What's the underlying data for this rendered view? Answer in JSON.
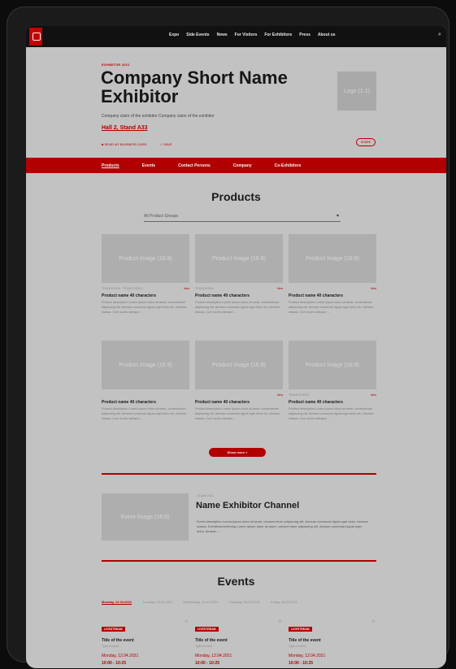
{
  "header": {
    "nav": [
      "Expo",
      "Side Events",
      "News",
      "For Visitors",
      "For Exhibitors",
      "Press",
      "About us"
    ],
    "search_icon": "search-icon"
  },
  "hero": {
    "eyebrow": "EXHIBITOR 2021",
    "title": "Company Short Name Exhibitor",
    "claim": "Company claim of the exhibitor Company claim of the exhibitor",
    "stand": "Hall 2, Stand A33",
    "meta": [
      "SEND MY BUSINESS CARD",
      "SAVE"
    ],
    "share": "SHARE",
    "logo_placeholder": "Logo (1:1)"
  },
  "tabs": [
    "Products",
    "Events",
    "Contact Persons",
    "Company",
    "Co-Exhibitors"
  ],
  "products": {
    "title": "Products",
    "filter": "All Product Groups",
    "cards": [
      {
        "img": "Product Image (16:9)",
        "tag": "TRADESHOW · TRADE-PRESS",
        "new": "New",
        "name": "Product name 40 characters",
        "desc": "Product description Lorem ipsum dolor sit amet, consectetuer adipiscing elit. Aenean commodo ligula eget dolor elu. Aenean massa. Cum sociis natoque ..."
      },
      {
        "img": "Product Image (16:9)",
        "tag": "TRADESHOW",
        "new": "New",
        "name": "Product name 40 characters",
        "desc": "Product description Lorem ipsum dolor sit amet, consectetuer adipiscing elit. Aenean commodo ligula eget dolor elu. Aenean massa. Cum sociis natoque ..."
      },
      {
        "img": "Product Image (16:9)",
        "tag": "",
        "new": "New",
        "name": "Product name 40 characters",
        "desc": "Product description Lorem ipsum dolor sit amet, consectetuer adipiscing elit. Aenean commodo ligula eget dolor elu. Aenean massa. Cum sociis natoque ..."
      },
      {
        "img": "Product Image (16:9)",
        "tag": "",
        "new": "",
        "name": "Product name 40 characters",
        "desc": "Product description Lorem ipsum dolor sit amet, consectetuer adipiscing elit. Aenean commodo ligula eget dolor elu. Aenean massa. Cum sociis natoque ..."
      },
      {
        "img": "Product Image (16:9)",
        "tag": "",
        "new": "New",
        "name": "Product name 40 characters",
        "desc": "Product description Lorem ipsum dolor sit amet, consectetuer adipiscing elit. Aenean commodo ligula eget dolor elu. Aenean massa. Cum sociis natoque ..."
      },
      {
        "img": "Product Image (16:9)",
        "tag": "TRADE-PRESS",
        "new": "New",
        "name": "Product name 40 characters",
        "desc": "Product description Lorem ipsum dolor sit amet, consectetuer adipiscing elit. Aenean commodo ligula eget dolor elu. Aenean massa. Cum sociis natoque ..."
      }
    ],
    "show_more": "Show more »"
  },
  "channel": {
    "img": "Event Image (16:9)",
    "date": "12 April 2021",
    "title": "Name Exhibitor Channel",
    "desc": "Event description Lorem ipsum dolor sit amet, consect etuer adipiscing elit. Aenean commodo ligula eget dolor. Aenean massa. Eventbeschreibung Lorem ipsum dolor sit amet, consect etuer adipiscing elit. Aenean commodo ligula eget dolor. Aenean ..."
  },
  "events": {
    "title": "Events",
    "days": [
      "Monday, 12.04.2021",
      "Tuesday, 13.04.2021",
      "Wednesday, 14.04.2021",
      "Thursday, 15.04.2021",
      "Friday, 16.04.2021"
    ],
    "items": [
      {
        "badge": "LIVESTREAM",
        "title": "Title of the event",
        "type": "Type of event",
        "date": "Monday, 12.04.2021",
        "time": "10:00 - 10:25"
      },
      {
        "badge": "LIVESTREAM",
        "title": "Title of the event",
        "type": "Type of event",
        "date": "Monday, 12.04.2021",
        "time": "10:00 - 10:25"
      },
      {
        "badge": "LIVESTREAM",
        "title": "Title of the event",
        "type": "Type of event",
        "date": "Monday, 12.04.2021",
        "time": "10:00 - 10:25"
      }
    ]
  },
  "colors": {
    "accent": "#b10000",
    "overlay_bg": "#c2c2c2",
    "topbar": "#111111"
  }
}
